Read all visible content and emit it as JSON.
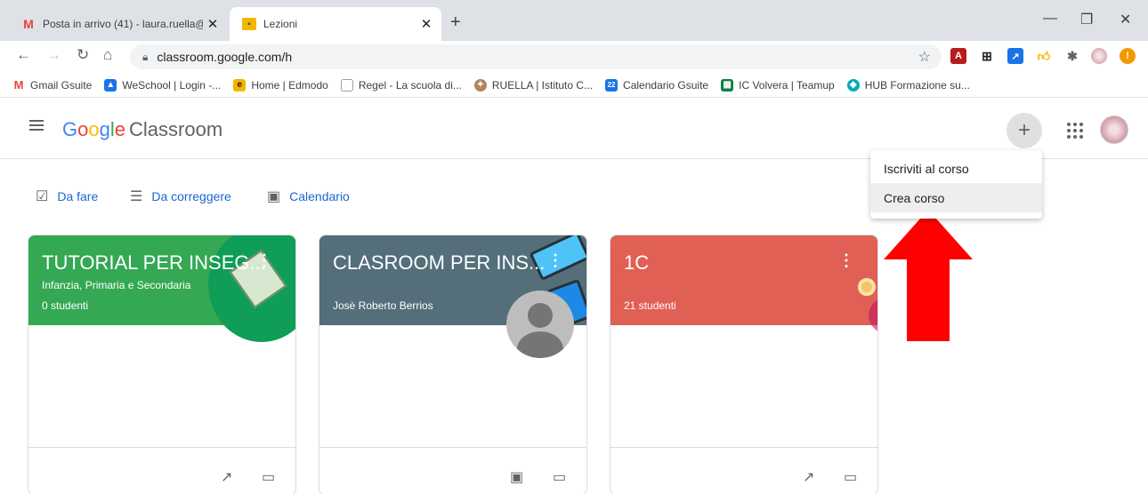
{
  "browser": {
    "tabs": [
      {
        "title": "Posta in arrivo (41) - laura.ruella@",
        "icon": "gmail-icon",
        "active": false
      },
      {
        "title": "Lezioni",
        "icon": "classroom-icon",
        "active": true
      }
    ],
    "url": "classroom.google.com/h",
    "bookmarks": [
      {
        "label": "Gmail Gsuite",
        "icon": "gmail-icon",
        "color": "#ea4335"
      },
      {
        "label": "WeSchool | Login -...",
        "icon": "weschool-icon",
        "color": "#1a73e8"
      },
      {
        "label": "Home | Edmodo",
        "icon": "edmodo-icon",
        "color": "#f4b400"
      },
      {
        "label": "Regel - La scuola di...",
        "icon": "page-icon",
        "color": "#9aa0a6"
      },
      {
        "label": "RUELLA | Istituto C...",
        "icon": "seal-icon",
        "color": "#b0855b"
      },
      {
        "label": "Calendario Gsuite",
        "icon": "calendar-icon",
        "color": "#1a73e8"
      },
      {
        "label": "IC Volvera | Teamup",
        "icon": "teamup-icon",
        "color": "#0b8043"
      },
      {
        "label": "HUB Formazione su...",
        "icon": "hub-icon",
        "color": "#00acc1"
      }
    ]
  },
  "app": {
    "brand_google": "Google",
    "brand_product": "Classroom",
    "menu": [
      {
        "label": "Iscriviti al corso",
        "highlighted": false
      },
      {
        "label": "Crea corso",
        "highlighted": true
      }
    ],
    "subnav": [
      {
        "label": "Da fare",
        "icon": "todo-checklist-icon"
      },
      {
        "label": "Da correggere",
        "icon": "review-list-icon"
      },
      {
        "label": "Calendario",
        "icon": "calendar-icon"
      }
    ],
    "cards": [
      {
        "title": "TUTORIAL PER INSEG...",
        "section": "Infanzia, Primaria e Secondaria",
        "info": "0 studenti",
        "color": "#34a853",
        "footer_icons": [
          "trending-up-icon",
          "folder-icon"
        ]
      },
      {
        "title": "CLASROOM PER INS...",
        "section": "",
        "info": "Josè Roberto Berrios",
        "color": "#546e7a",
        "footer_icons": [
          "assignment-ind-icon",
          "folder-icon"
        ]
      },
      {
        "title": "1C",
        "section": "",
        "info": "21 studenti",
        "color": "#e06055",
        "footer_icons": [
          "trending-up-icon",
          "folder-icon"
        ]
      }
    ],
    "colors": {
      "accent": "#1967d2",
      "arrow": "#ff0000"
    }
  }
}
